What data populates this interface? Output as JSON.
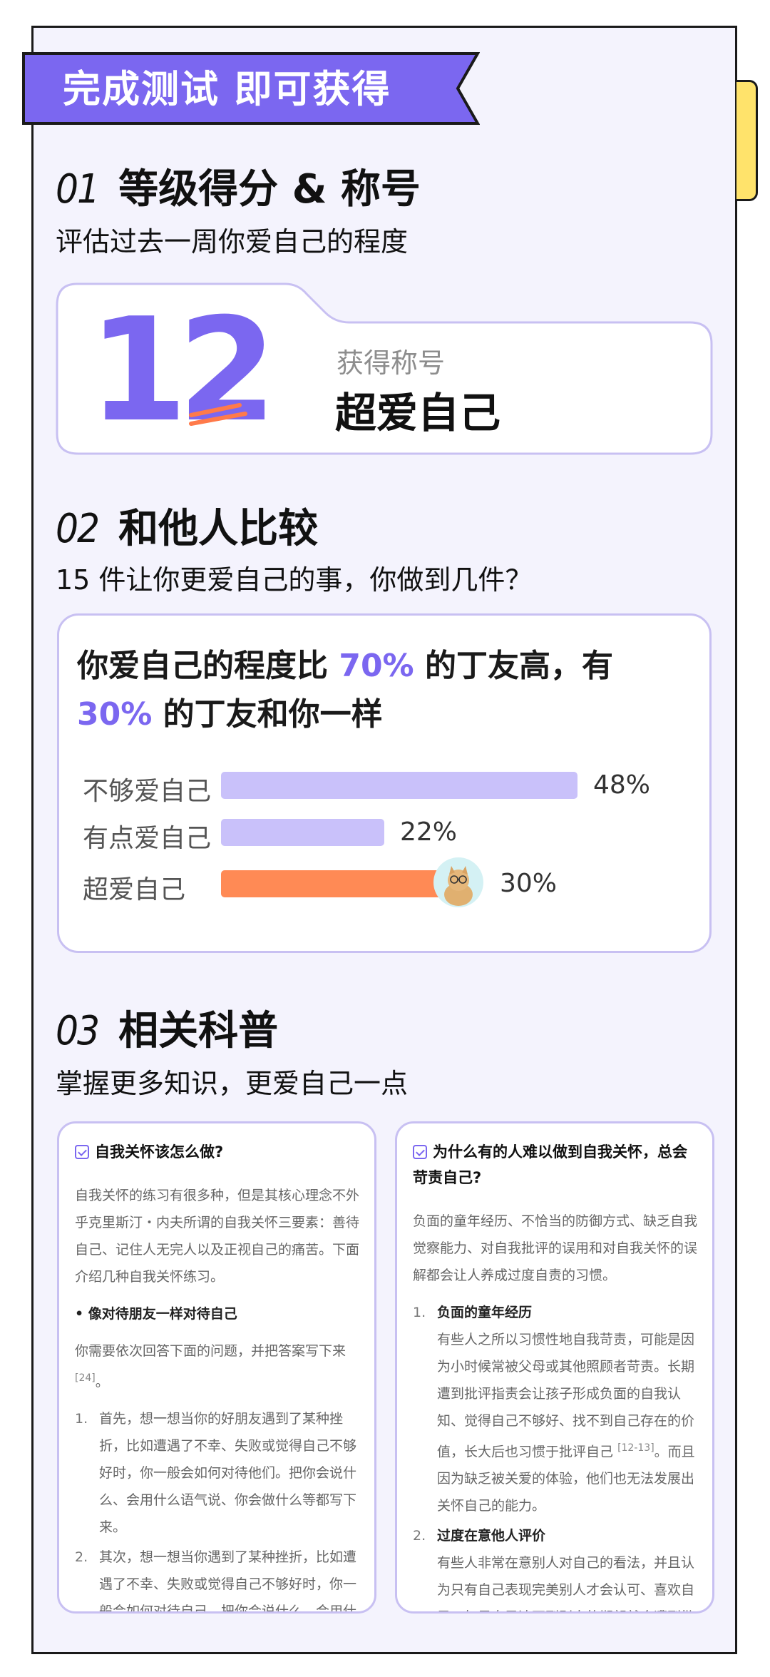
{
  "banner": {
    "text": "完成测试 即可获得"
  },
  "section1": {
    "num": "01",
    "title": "等级得分 & 称号",
    "subtitle": "评估过去一周你爱自己的程度",
    "score": "12",
    "title_label": "获得称号",
    "title_value": "超爱自己"
  },
  "section2": {
    "num": "02",
    "title": "和他人比较",
    "subtitle": "15 件让你更爱自己的事，你做到几件？",
    "headline": {
      "part1": "你爱自己的程度比 ",
      "pct_higher": "70%",
      "part2": " 的丁友高，有 ",
      "pct_same": "30%",
      "part3": " 的丁友和你一样"
    },
    "bars": [
      {
        "label": "不够爱自己",
        "pct": "48%",
        "value": 48,
        "color": "#c9c1fa"
      },
      {
        "label": "有点爱自己",
        "pct": "22%",
        "value": 22,
        "color": "#c9c1fa"
      },
      {
        "label": "超爱自己",
        "pct": "30%",
        "value": 30,
        "color": "#ff8a55"
      }
    ]
  },
  "section3": {
    "num": "03",
    "title": "相关科普",
    "subtitle": "掌握更多知识，更爱自己一点",
    "card_left": {
      "heading": "自我关怀该怎么做?",
      "intro": "自我关怀的练习有很多种，但是其核心理念不外乎克里斯汀・内夫所谓的自我关怀三要素：善待自己、记住人无完人以及正视自己的痛苦。下面介绍几种自我关怀练习。",
      "bullet": "• 像对待朋友一样对待自己",
      "para": "你需要依次回答下面的问题，并把答案写下来",
      "para_ref": "[24]",
      "para_end": "。",
      "items": [
        {
          "n": "1.",
          "text": "首先，想一想当你的好朋友遇到了某种挫折，比如遭遇了不幸、失败或觉得自己不够好时，你一般会如何对待他们。把你会说什么、会用什么语气说、你会做什么等都写下来。"
        },
        {
          "n": "2.",
          "text": "其次，想一想当你遇到了某种挫折，比如遭遇了不幸、失败或觉得自己不够好时，你一般会如何对待自己。把你会说什么、会用什"
        }
      ]
    },
    "card_right": {
      "heading": "为什么有的人难以做到自我关怀，总会苛责自己?",
      "intro": "负面的童年经历、不恰当的防御方式、缺乏自我觉察能力、对自我批评的误用和对自我关怀的误解都会让人养成过度自责的习惯。",
      "items": [
        {
          "n": "1.",
          "title": "负面的童年经历",
          "text": "有些人之所以习惯性地自我苛责，可能是因为小时候常被父母或其他照顾者苛责。长期遭到批评指责会让孩子形成负面的自我认知、觉得自己不够好、找不到自己存在的价值，长大后也习惯于批评自己",
          "ref": "[12-13]",
          "text2": "。而且因为缺乏被关爱的体验，他们也无法发展出关怀自己的能力。"
        },
        {
          "n": "2.",
          "title": "过度在意他人评价",
          "text": "有些人非常在意别人对自己的看法，并且认为只有自己表现完美别人才会认可、喜欢自己，如果自己达不到别人的期望就会遭到批",
          "ref": "",
          "text2": ""
        }
      ]
    }
  }
}
